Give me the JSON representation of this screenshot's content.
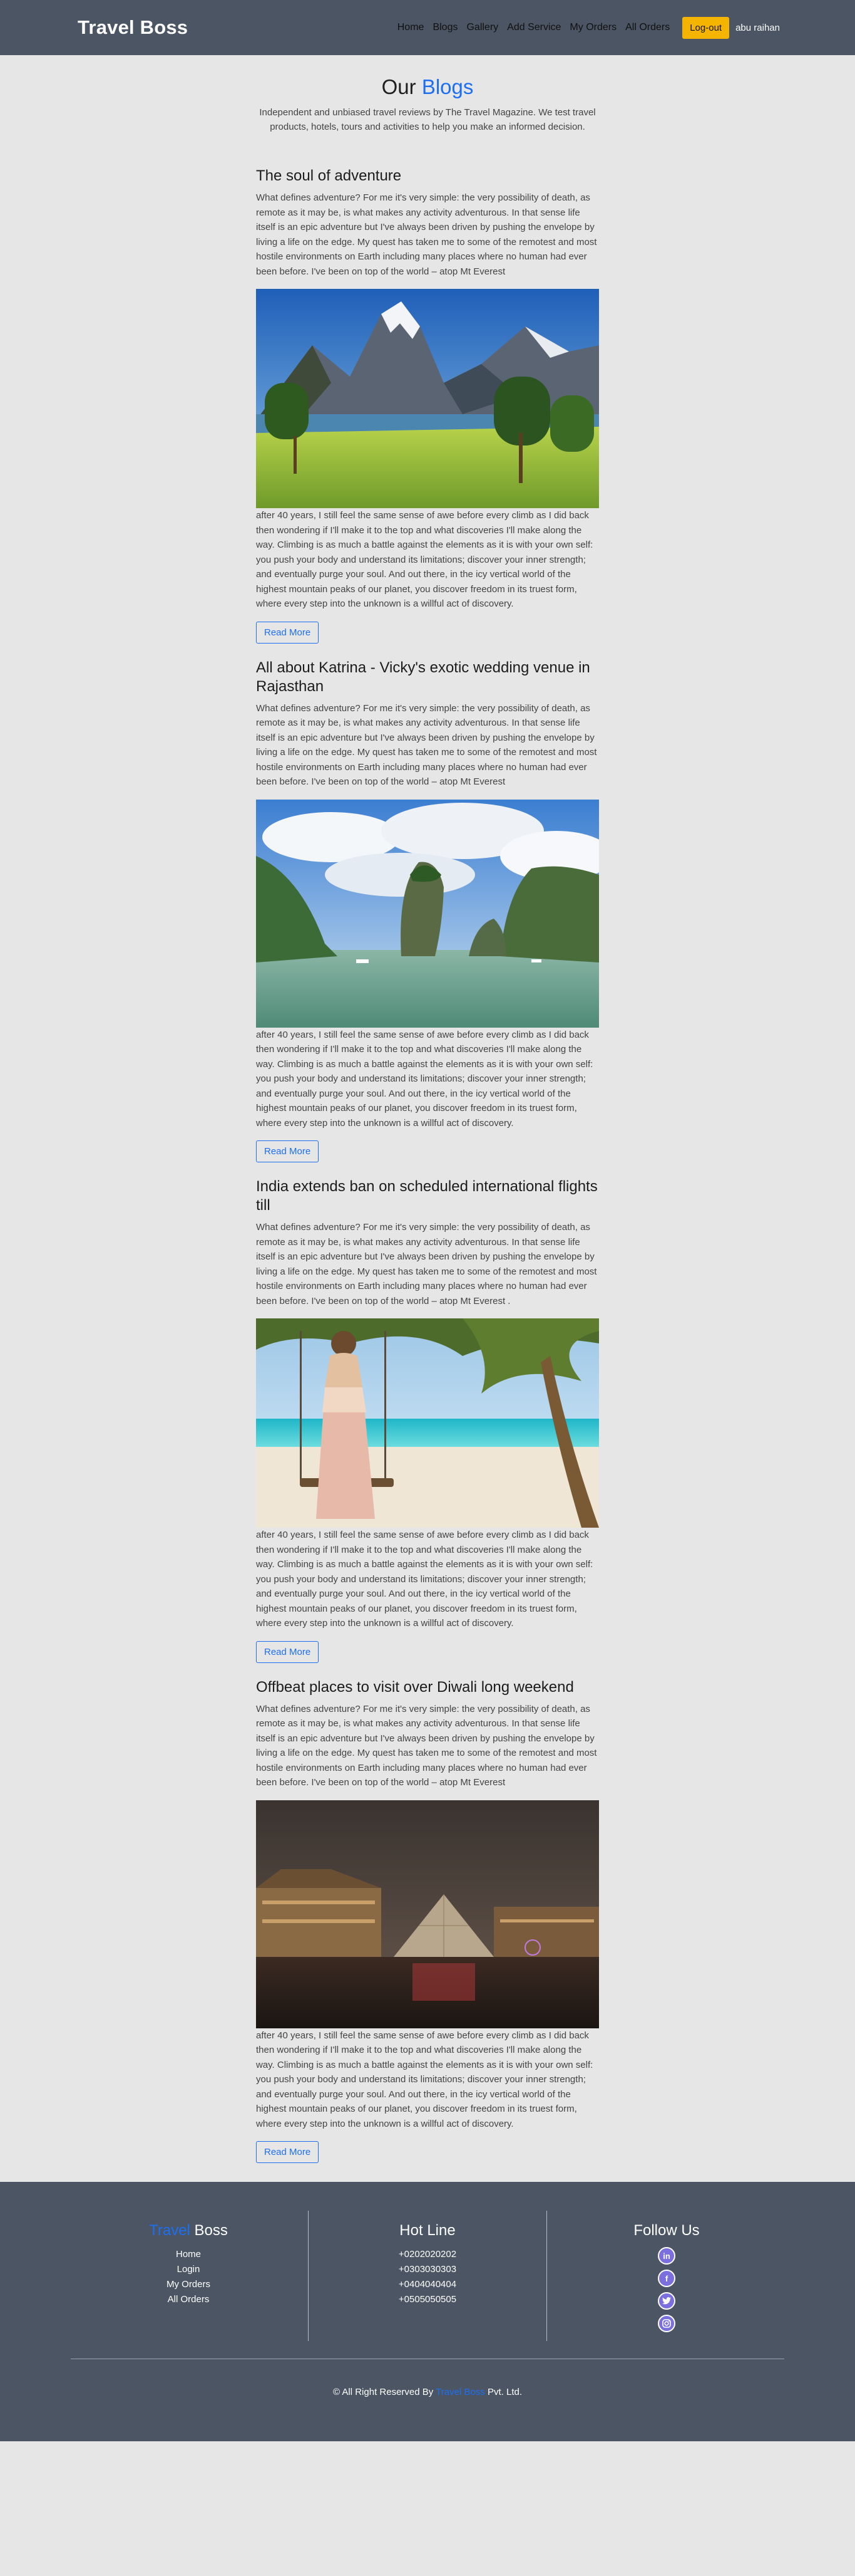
{
  "header": {
    "brand": "Travel Boss",
    "nav": [
      "Home",
      "Blogs",
      "Gallery",
      "Add Service",
      "My Orders",
      "All Orders"
    ],
    "logout_label": "Log-out",
    "user_name": "abu raihan"
  },
  "page": {
    "title_plain": "Our ",
    "title_accent": "Blogs",
    "subtitle": "Independent and unbiased travel reviews by The Travel Magazine. We test travel products, hotels, tours and activities to help you make an informed decision."
  },
  "posts": [
    {
      "title": "The soul of adventure",
      "intro": "What defines adventure? For me it's very simple: the very possibility of death, as remote as it may be, is what makes any activity adventurous. In that sense life itself is an epic adventure but I've always been driven by pushing the envelope by living a life on the edge. My quest has taken me to some of the remotest and most hostile environments on Earth including many places where no human had ever been before. I've been on top of the world – atop Mt Everest",
      "body": "after 40 years, I still feel the same sense of awe before every climb as I did back then wondering if I'll make it to the top and what discoveries I'll make along the way. Climbing is as much a battle against the elements as it is with your own self: you push your body and understand its limitations; discover your inner strength; and eventually purge your soul. And out there, in the icy vertical world of the highest mountain peaks of our planet, you discover freedom in its truest form, where every step into the unknown is a willful act of discovery.",
      "read_more": "Read More",
      "image": "mountain-fjord-photo"
    },
    {
      "title": "All about Katrina - Vicky's exotic wedding venue in Rajasthan",
      "intro": "What defines adventure? For me it's very simple: the very possibility of death, as remote as it may be, is what makes any activity adventurous. In that sense life itself is an epic adventure but I've always been driven by pushing the envelope by living a life on the edge. My quest has taken me to some of the remotest and most hostile environments on Earth including many places where no human had ever been before. I've been on top of the world – atop Mt Everest",
      "body": "after 40 years, I still feel the same sense of awe before every climb as I did back then wondering if I'll make it to the top and what discoveries I'll make along the way. Climbing is as much a battle against the elements as it is with your own self: you push your body and understand its limitations; discover your inner strength; and eventually purge your soul. And out there, in the icy vertical world of the highest mountain peaks of our planet, you discover freedom in its truest form, where every step into the unknown is a willful act of discovery.",
      "read_more": "Read More",
      "image": "island-rocks-photo"
    },
    {
      "title": "India extends ban on scheduled international flights till",
      "intro": "What defines adventure? For me it's very simple: the very possibility of death, as remote as it may be, is what makes any activity adventurous. In that sense life itself is an epic adventure but I've always been driven by pushing the envelope by living a life on the edge. My quest has taken me to some of the remotest and most hostile environments on Earth including many places where no human had ever been before. I've been on top of the world – atop Mt Everest .",
      "body": "after 40 years, I still feel the same sense of awe before every climb as I did back then wondering if I'll make it to the top and what discoveries I'll make along the way. Climbing is as much a battle against the elements as it is with your own self: you push your body and understand its limitations; discover your inner strength; and eventually purge your soul. And out there, in the icy vertical world of the highest mountain peaks of our planet, you discover freedom in its truest form, where every step into the unknown is a willful act of discovery.",
      "read_more": "Read More",
      "image": "beach-swing-photo"
    },
    {
      "title": "Offbeat places to visit over Diwali long weekend",
      "intro": "What defines adventure? For me it's very simple: the very possibility of death, as remote as it may be, is what makes any activity adventurous. In that sense life itself is an epic adventure but I've always been driven by pushing the envelope by living a life on the edge. My quest has taken me to some of the remotest and most hostile environments on Earth including many places where no human had ever been before. I've been on top of the world – atop Mt Everest",
      "body": "after 40 years, I still feel the same sense of awe before every climb as I did back then wondering if I'll make it to the top and what discoveries I'll make along the way. Climbing is as much a battle against the elements as it is with your own self: you push your body and understand its limitations; discover your inner strength; and eventually purge your soul. And out there, in the icy vertical world of the highest mountain peaks of our planet, you discover freedom in its truest form, where every step into the unknown is a willful act of discovery.",
      "read_more": "Read More",
      "image": "louvre-night-photo"
    }
  ],
  "footer": {
    "brand_accent": "Travel",
    "brand_plain": " Boss",
    "links": [
      "Home",
      "Login",
      "My Orders",
      "All Orders"
    ],
    "hotline_title": "Hot Line",
    "phones": [
      "+0202020202",
      "+0303030303",
      "+0404040404",
      "+0505050505"
    ],
    "follow_title": "Follow Us",
    "social_icons": [
      "linkedin-icon",
      "facebook-icon",
      "twitter-icon",
      "instagram-icon"
    ],
    "copyright_pre": "© All Right Reserved By ",
    "copyright_accent": "Travel Boss",
    "copyright_post": " Pvt. Ltd."
  },
  "colors": {
    "header_bg": "#4b5563",
    "page_bg": "#e6e6e6",
    "accent": "#1d6ff2",
    "logout_bg": "#f5b400"
  }
}
